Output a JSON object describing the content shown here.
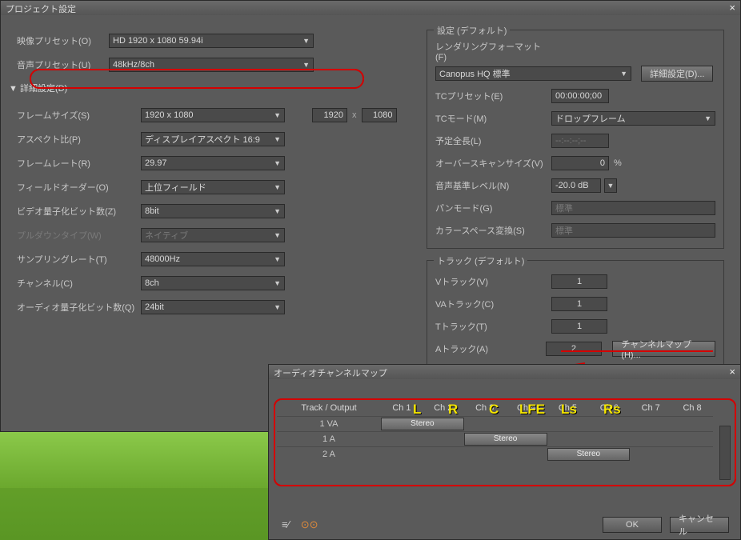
{
  "main": {
    "title": "プロジェクト設定",
    "videoPresetLabel": "映像プリセット(O)",
    "videoPresetValue": "HD 1920 x 1080 59.94i",
    "audioPresetLabel": "音声プリセット(U)",
    "audioPresetValue": "48kHz/8ch",
    "detailToggle": "詳細設定(D)",
    "rows": {
      "frameSize": {
        "label": "フレームサイズ(S)",
        "value": "1920 x 1080",
        "w": "1920",
        "h": "1080"
      },
      "aspect": {
        "label": "アスペクト比(P)",
        "value": "ディスプレイアスペクト 16:9"
      },
      "frameRate": {
        "label": "フレームレート(R)",
        "value": "29.97"
      },
      "fieldOrder": {
        "label": "フィールドオーダー(O)",
        "value": "上位フィールド"
      },
      "videoQuant": {
        "label": "ビデオ量子化ビット数(Z)",
        "value": "8bit"
      },
      "pulldown": {
        "label": "プルダウンタイプ(W)",
        "value": "ネイティブ"
      },
      "sampleRate": {
        "label": "サンプリングレート(T)",
        "value": "48000Hz"
      },
      "channel": {
        "label": "チャンネル(C)",
        "value": "8ch"
      },
      "audioQuant": {
        "label": "オーディオ量子化ビット数(Q)",
        "value": "24bit"
      }
    }
  },
  "settings": {
    "header": "設定 (デフォルト)",
    "renderFmtLabel": "レンダリングフォーマット(F)",
    "renderFmtValue": "Canopus HQ 標準",
    "detailBtn": "詳細設定(D)...",
    "tcPresetLabel": "TCプリセット(E)",
    "tcPresetValue": "00:00:00;00",
    "tcModeLabel": "TCモード(M)",
    "tcModeValue": "ドロップフレーム",
    "totalLenLabel": "予定全長(L)",
    "totalLenValue": "--:--:--;--",
    "overscanLabel": "オーバースキャンサイズ(V)",
    "overscanValue": "0",
    "overscanUnit": "%",
    "audioRefLabel": "音声基準レベル(N)",
    "audioRefValue": "-20.0 dB",
    "panLabel": "パンモード(G)",
    "panValue": "標準",
    "colorLabel": "カラースペース変換(S)",
    "colorValue": "標準"
  },
  "tracks": {
    "header": "トラック (デフォルト)",
    "vLabel": "Vトラック(V)",
    "vValue": "1",
    "vaLabel": "VAトラック(C)",
    "vaValue": "1",
    "tLabel": "Tトラック(T)",
    "tValue": "1",
    "aLabel": "Aトラック(A)",
    "aValue": "2",
    "chMapBtn": "チャンネルマップ(H)..."
  },
  "sub": {
    "title": "オーディオチャンネルマップ",
    "th0": "Track / Output",
    "ch": [
      "Ch 1",
      "Ch 2",
      "Ch 3",
      "Ch 4",
      "Ch 5",
      "Ch 6",
      "Ch 7",
      "Ch 8"
    ],
    "ann": [
      "L",
      "R",
      "C",
      "LFE",
      "Ls",
      "Rs"
    ],
    "rows": [
      "1 VA",
      "1 A",
      "2 A"
    ],
    "stereo": "Stereo",
    "ok": "OK",
    "cancel": "キャンセル"
  }
}
